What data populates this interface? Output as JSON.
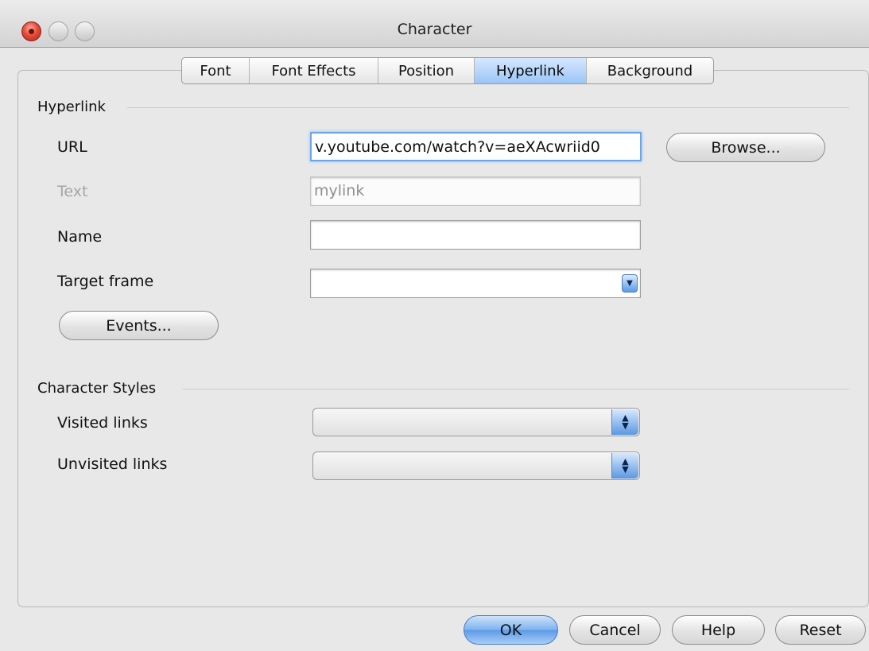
{
  "window": {
    "title": "Character"
  },
  "tabs": [
    {
      "label": "Font"
    },
    {
      "label": "Font Effects"
    },
    {
      "label": "Position"
    },
    {
      "label": "Hyperlink",
      "active": true
    },
    {
      "label": "Background"
    }
  ],
  "hyperlink": {
    "section_title": "Hyperlink",
    "url": {
      "label": "URL",
      "value": "v.youtube.com/watch?v=aeXAcwriid0"
    },
    "browse_label": "Browse...",
    "text": {
      "label": "Text",
      "value": "mylink"
    },
    "name": {
      "label": "Name",
      "value": ""
    },
    "target_frame": {
      "label": "Target frame",
      "value": ""
    },
    "events_label": "Events..."
  },
  "character_styles": {
    "section_title": "Character Styles",
    "visited": {
      "label": "Visited links",
      "value": ""
    },
    "unvisited": {
      "label": "Unvisited links",
      "value": ""
    }
  },
  "footer": {
    "ok_label": "OK",
    "cancel_label": "Cancel",
    "help_label": "Help",
    "reset_label": "Reset"
  },
  "colors": {
    "accent_blue": "#5b9ae6",
    "focus_ring": "#6aa5e8",
    "close_button": "#e64a3a",
    "disabled_text": "#a5a5a5"
  }
}
